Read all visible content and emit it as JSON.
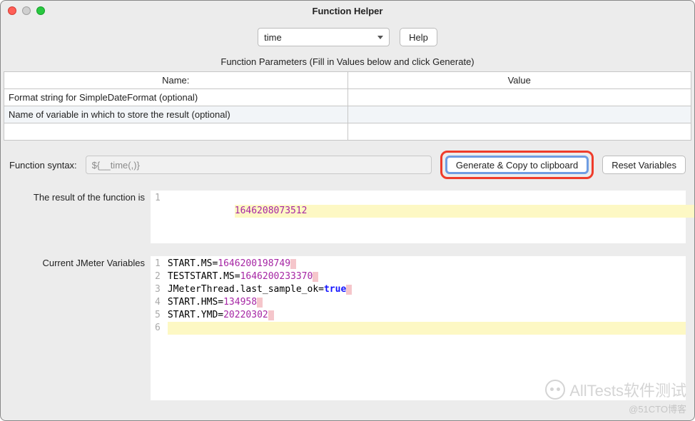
{
  "window": {
    "title": "Function Helper"
  },
  "top": {
    "function_select": "time",
    "help_label": "Help"
  },
  "params": {
    "caption": "Function Parameters (Fill in Values below and click Generate)",
    "headers": {
      "name": "Name:",
      "value": "Value"
    },
    "rows": [
      {
        "name": "Format string for SimpleDateFormat (optional)",
        "value": ""
      },
      {
        "name": "Name of variable in which to store the result (optional)",
        "value": ""
      }
    ]
  },
  "syntax": {
    "label": "Function syntax:",
    "value": "${__time(,)}",
    "generate_label": "Generate & Copy to clipboard",
    "reset_label": "Reset Variables"
  },
  "result": {
    "label": "The result of the function is",
    "value": "1646208073512"
  },
  "variables": {
    "label": "Current JMeter Variables",
    "lines": [
      {
        "key": "START.MS",
        "value": "1646200198749",
        "type": "num"
      },
      {
        "key": "TESTSTART.MS",
        "value": "1646200233370",
        "type": "num"
      },
      {
        "key": "JMeterThread.last_sample_ok",
        "value": "true",
        "type": "bool"
      },
      {
        "key": "START.HMS",
        "value": "134958",
        "type": "num"
      },
      {
        "key": "START.YMD",
        "value": "20220302",
        "type": "num"
      }
    ]
  },
  "watermarks": {
    "w1": "AllTests软件测试",
    "w2": "@51CTO博客"
  }
}
